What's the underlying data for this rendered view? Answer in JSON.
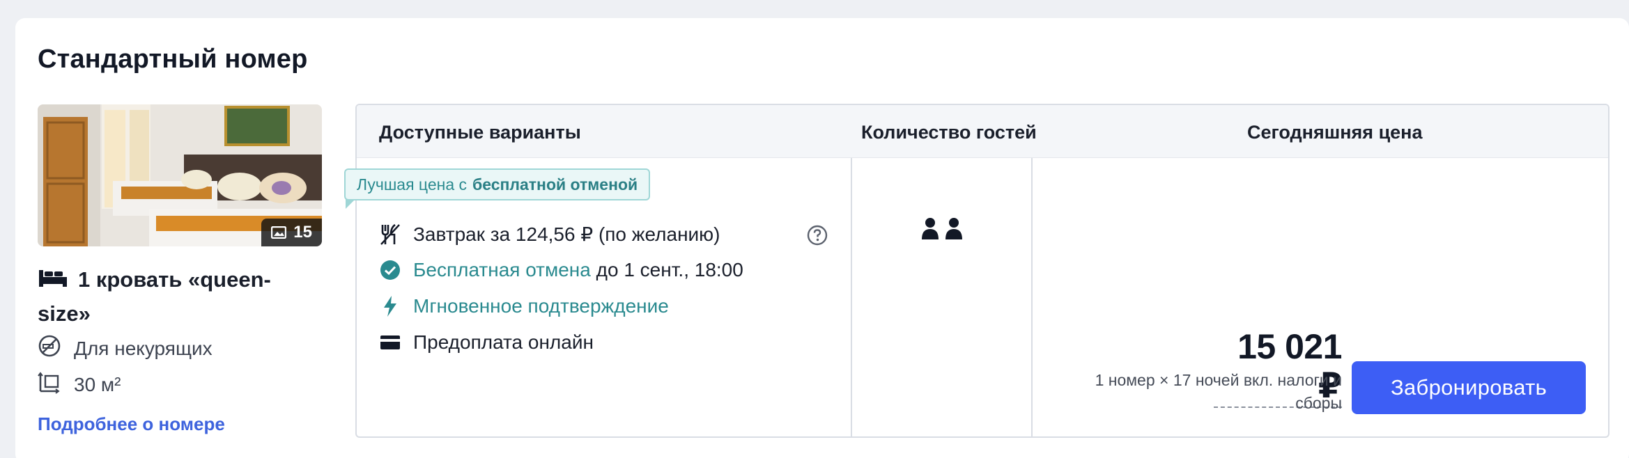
{
  "room": {
    "title": "Стандартный номер",
    "photo_count": "15",
    "bed": "1 кровать «queen-size»",
    "smoking": "Для некурящих",
    "area": "30 м²",
    "more_link": "Подробнее о номере"
  },
  "table": {
    "headers": [
      "Доступные варианты",
      "Количество гостей",
      "Сегодняшняя цена"
    ]
  },
  "option": {
    "badge_prefix": "Лучшая цена с",
    "badge_bold": "бесплатной отменой",
    "breakfast": "Завтрак за 124,56 ₽ (по желанию)",
    "cancel_link": "Бесплатная отмена",
    "cancel_until": "до 1 сент., 18:00",
    "instant": "Мгновенное подтверждение",
    "prepay": "Предоплата онлайн",
    "guests_count": 2
  },
  "pricing": {
    "price": "15 021 ₽",
    "note": "1 номер × 17 ночей вкл. налоги и сборы",
    "book_label": "Забронировать"
  },
  "colors": {
    "accent": "#3d5ef5",
    "teal": "#2a8a8f",
    "link": "#3e63dd"
  },
  "icons": {
    "breakfast": "utensils-icon",
    "cancel": "check-circle-icon",
    "instant": "lightning-icon",
    "prepay": "credit-card-icon",
    "help": "question-circle-icon",
    "guests": "person-icon",
    "bed": "bed-icon",
    "smoking": "no-smoking-icon",
    "area": "room-area-icon",
    "photos": "gallery-icon"
  }
}
